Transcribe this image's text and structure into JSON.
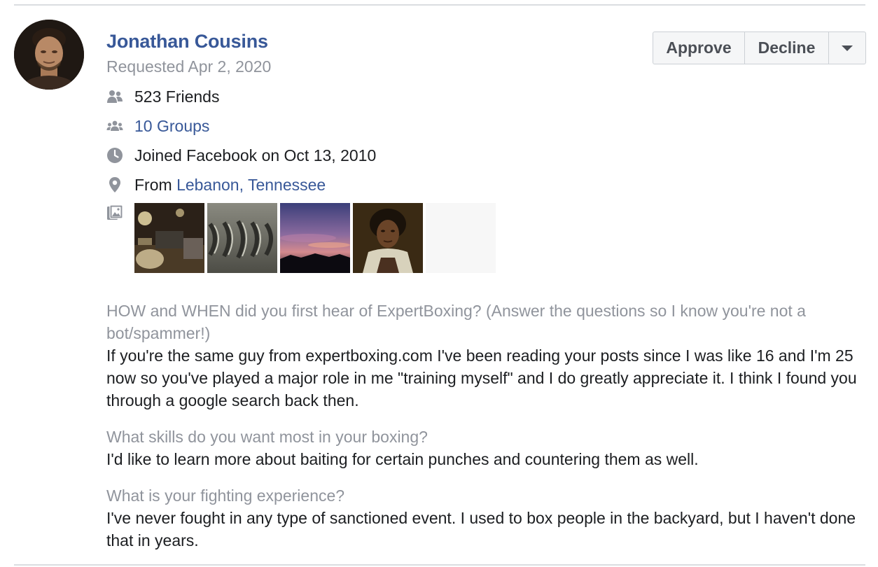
{
  "request": {
    "name": "Jonathan Cousins",
    "requested": "Requested Apr 2, 2020",
    "friends": "523 Friends",
    "groups": "10 Groups",
    "joined": "Joined Facebook on Oct 13, 2010",
    "from_prefix": "From ",
    "from_location": "Lebanon, Tennessee"
  },
  "actions": {
    "approve_label": "Approve",
    "decline_label": "Decline"
  },
  "icons": {
    "friends": "friends-icon",
    "groups": "groups-icon",
    "joined": "clock-icon",
    "from": "location-pin-icon",
    "photos": "photos-icon",
    "more": "chevron-down-icon"
  },
  "questions": [
    {
      "question": "HOW and WHEN did you first hear of ExpertBoxing? (Answer the questions so I know you're not a bot/spammer!)",
      "answer": "If you're the same guy from expertboxing.com I've been reading your posts since I was like 16 and I'm 25 now so you've played a major role in me \"training myself\" and I do greatly appreciate it. I think I found you through a google search back then."
    },
    {
      "question": "What skills do you want most in your boxing?",
      "answer": "I'd like to learn more about baiting for certain punches and countering them as well."
    },
    {
      "question": "What is your fighting experience?",
      "answer": "I've never fought in any type of sanctioned event. I used to box people in the backyard, but I haven't done that in years."
    }
  ],
  "colors": {
    "link": "#385898",
    "secondary_text": "#90949c",
    "primary_text": "#1c1e21",
    "icon": "#90949c",
    "divider": "#dadde1"
  }
}
